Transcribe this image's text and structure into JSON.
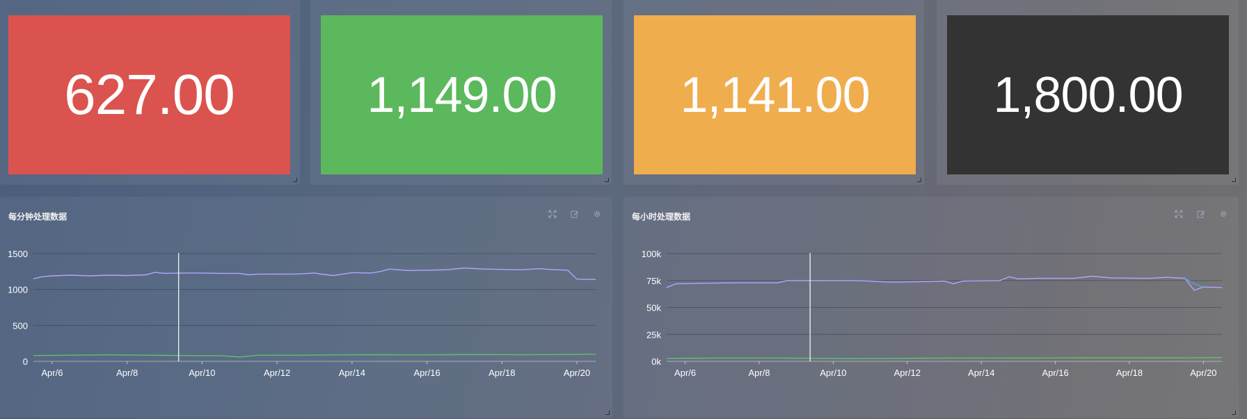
{
  "stats": [
    {
      "value": "627.00",
      "color": "#db534e"
    },
    {
      "value": "1,149.00",
      "color": "#5cb85c"
    },
    {
      "value": "1,141.00",
      "color": "#f0ad4e"
    },
    {
      "value": "1,800.00",
      "color": "#333333"
    }
  ],
  "panels": [
    {
      "title": "每分钟处理数据",
      "tools": [
        "fullscreen-icon",
        "edit-icon",
        "gear-icon"
      ]
    },
    {
      "title": "每小时处理数据",
      "tools": [
        "fullscreen-icon",
        "edit-icon",
        "gear-icon"
      ]
    }
  ],
  "chart_data": [
    {
      "type": "line",
      "title": "每分钟处理数据",
      "xlim": [
        "2019-04-05T12:00",
        "2019-04-20T12:00"
      ],
      "x_ticks": [
        "Apr/6",
        "Apr/8",
        "Apr/10",
        "Apr/12",
        "Apr/14",
        "Apr/16",
        "Apr/18",
        "Apr/20"
      ],
      "y_ticks": [
        "0",
        "500",
        "1000",
        "1500"
      ],
      "ylim": [
        0,
        1500
      ],
      "grid": true,
      "cursor_x": "2019-04-09T09:00",
      "series": [
        {
          "color": "#b3a5ff",
          "x": [
            "2019-04-05T12:00",
            "2019-04-05T18:00",
            "2019-04-06T00:00",
            "2019-04-06T12:00",
            "2019-04-07T00:00",
            "2019-04-07T12:00",
            "2019-04-08T00:00",
            "2019-04-08T12:00",
            "2019-04-08T18:00",
            "2019-04-09T00:00",
            "2019-04-09T12:00",
            "2019-04-10T00:00",
            "2019-04-10T12:00",
            "2019-04-11T00:00",
            "2019-04-11T06:00",
            "2019-04-11T12:00",
            "2019-04-12T00:00",
            "2019-04-12T12:00",
            "2019-04-13T00:00",
            "2019-04-13T06:00",
            "2019-04-13T12:00",
            "2019-04-14T00:00",
            "2019-04-14T12:00",
            "2019-04-14T18:00",
            "2019-04-15T00:00",
            "2019-04-15T12:00",
            "2019-04-16T00:00",
            "2019-04-16T12:00",
            "2019-04-17T00:00",
            "2019-04-17T12:00",
            "2019-04-18T00:00",
            "2019-04-18T12:00",
            "2019-04-19T00:00",
            "2019-04-19T06:00",
            "2019-04-19T12:00",
            "2019-04-19T18:00",
            "2019-04-20T00:00",
            "2019-04-20T12:00"
          ],
          "values": [
            1150,
            1180,
            1190,
            1200,
            1190,
            1200,
            1195,
            1205,
            1240,
            1225,
            1230,
            1230,
            1225,
            1225,
            1205,
            1215,
            1215,
            1215,
            1230,
            1210,
            1195,
            1235,
            1230,
            1250,
            1285,
            1265,
            1270,
            1275,
            1300,
            1285,
            1280,
            1275,
            1290,
            1280,
            1275,
            1270,
            1145,
            1140
          ]
        },
        {
          "color": "#5ec36a",
          "x": [
            "2019-04-05T12:00",
            "2019-04-06T12:00",
            "2019-04-07T12:00",
            "2019-04-08T12:00",
            "2019-04-09T12:00",
            "2019-04-10T12:00",
            "2019-04-11T00:00",
            "2019-04-11T12:00",
            "2019-04-12T12:00",
            "2019-04-13T12:00",
            "2019-04-14T12:00",
            "2019-04-15T12:00",
            "2019-04-16T12:00",
            "2019-04-17T12:00",
            "2019-04-18T12:00",
            "2019-04-19T12:00",
            "2019-04-20T12:00"
          ],
          "values": [
            80,
            85,
            90,
            85,
            80,
            78,
            60,
            85,
            85,
            90,
            92,
            90,
            92,
            95,
            92,
            95,
            100
          ]
        }
      ]
    },
    {
      "type": "line",
      "title": "每小时处理数据",
      "xlim": [
        "2019-04-05T12:00",
        "2019-04-20T12:00"
      ],
      "x_ticks": [
        "Apr/6",
        "Apr/8",
        "Apr/10",
        "Apr/12",
        "Apr/14",
        "Apr/16",
        "Apr/18",
        "Apr/20"
      ],
      "y_ticks": [
        "0k",
        "25k",
        "50k",
        "75k",
        "100k"
      ],
      "ylim": [
        0,
        100000
      ],
      "grid": true,
      "cursor_x": "2019-04-09T09:00",
      "series": [
        {
          "color": "#b3a5ff",
          "x": [
            "2019-04-05T12:00",
            "2019-04-05T18:00",
            "2019-04-06T12:00",
            "2019-04-07T12:00",
            "2019-04-08T12:00",
            "2019-04-08T18:00",
            "2019-04-09T12:00",
            "2019-04-10T12:00",
            "2019-04-11T00:00",
            "2019-04-11T12:00",
            "2019-04-12T12:00",
            "2019-04-13T00:00",
            "2019-04-13T06:00",
            "2019-04-13T12:00",
            "2019-04-14T12:00",
            "2019-04-14T18:00",
            "2019-04-15T00:00",
            "2019-04-15T12:00",
            "2019-04-16T12:00",
            "2019-04-17T00:00",
            "2019-04-17T12:00",
            "2019-04-18T12:00",
            "2019-04-19T00:00",
            "2019-04-19T12:00",
            "2019-04-19T18:00",
            "2019-04-20T00:00",
            "2019-04-20T12:00"
          ],
          "values": [
            68500,
            72000,
            72500,
            73000,
            73000,
            75000,
            75000,
            75000,
            74500,
            73500,
            74000,
            74500,
            72000,
            74500,
            75000,
            78500,
            76500,
            77000,
            77000,
            79000,
            77500,
            77000,
            78000,
            77000,
            66000,
            69000,
            68500
          ]
        },
        {
          "color": "#4ea3e0",
          "x": [
            "2019-04-19T12:00",
            "2019-04-19T18:00",
            "2019-04-20T00:00"
          ],
          "values": [
            77000,
            72000,
            69000
          ]
        },
        {
          "color": "#5ec36a",
          "x": [
            "2019-04-05T12:00",
            "2019-04-06T12:00",
            "2019-04-07T12:00",
            "2019-04-08T12:00",
            "2019-04-09T12:00",
            "2019-04-10T12:00",
            "2019-04-11T12:00",
            "2019-04-12T12:00",
            "2019-04-13T12:00",
            "2019-04-14T12:00",
            "2019-04-15T12:00",
            "2019-04-16T12:00",
            "2019-04-17T12:00",
            "2019-04-18T12:00",
            "2019-04-19T12:00",
            "2019-04-20T12:00"
          ],
          "values": [
            2800,
            2900,
            3000,
            3000,
            2800,
            2600,
            2700,
            2900,
            3000,
            3100,
            3100,
            3200,
            3200,
            3200,
            3300,
            3400
          ]
        }
      ]
    }
  ]
}
